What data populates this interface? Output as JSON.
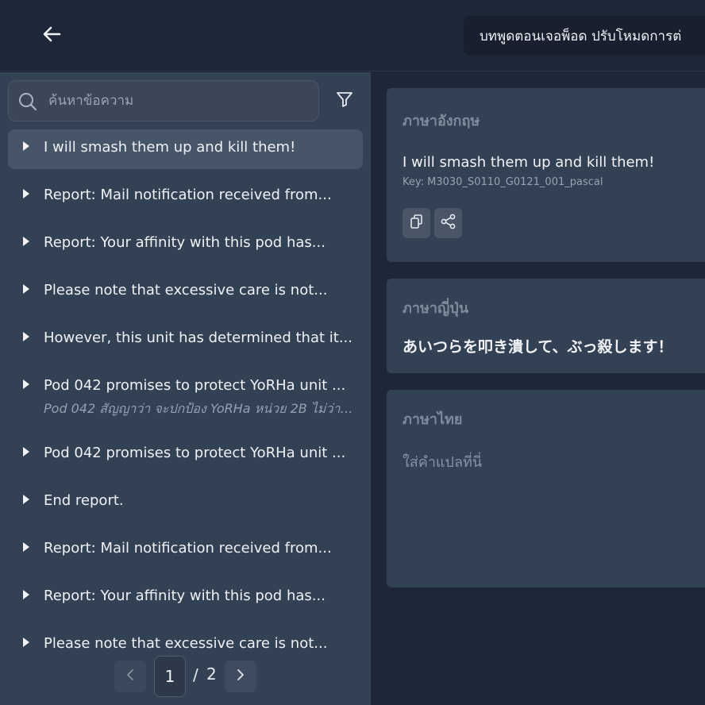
{
  "header": {
    "back_icon": "arrow-left-icon",
    "title": "บทพูดตอนเจอพ็อด ปรับโหมดการต่"
  },
  "search": {
    "placeholder": "ค้นหาข้อความ",
    "search_icon": "search-icon",
    "filter_icon": "filter-icon"
  },
  "list": {
    "items": [
      {
        "primary": "I will smash them up and kill them!",
        "secondary": ""
      },
      {
        "primary": "Report: Mail notification received from...",
        "secondary": ""
      },
      {
        "primary": "Report: Your affinity with this pod has...",
        "secondary": ""
      },
      {
        "primary": "Please note that excessive care is not...",
        "secondary": ""
      },
      {
        "primary": "However, this unit has determined that it...",
        "secondary": ""
      },
      {
        "primary": "Pod 042 promises to protect YoRHa unit ...",
        "secondary": "Pod 042 สัญญาว่า จะปกป้อง YoRHa หน่วย 2B ไม่ว่าใ..."
      },
      {
        "primary": "Pod 042 promises to protect YoRHa unit ...",
        "secondary": ""
      },
      {
        "primary": "End report.",
        "secondary": ""
      },
      {
        "primary": "Report: Mail notification received from...",
        "secondary": ""
      },
      {
        "primary": "Report: Your affinity with this pod has...",
        "secondary": ""
      },
      {
        "primary": "Please note that excessive care is not...",
        "secondary": ""
      }
    ]
  },
  "pagination": {
    "current": "1",
    "separator": "/",
    "total": "2"
  },
  "english_card": {
    "label": "ภาษาอังกฤษ",
    "text": "I will smash them up and kill them!",
    "key": "Key: M3030_S0110_G0121_001_pascal"
  },
  "japanese_card": {
    "label": "ภาษาญี่ปุ่น",
    "text": "あいつらを叩き潰して、ぶっ殺します！"
  },
  "thai_card": {
    "label": "ภาษาไทย",
    "placeholder": "ใส่คำแปลที่นี่"
  },
  "colors": {
    "background": "#1e2737",
    "panel": "#334155",
    "selected": "#475569"
  }
}
